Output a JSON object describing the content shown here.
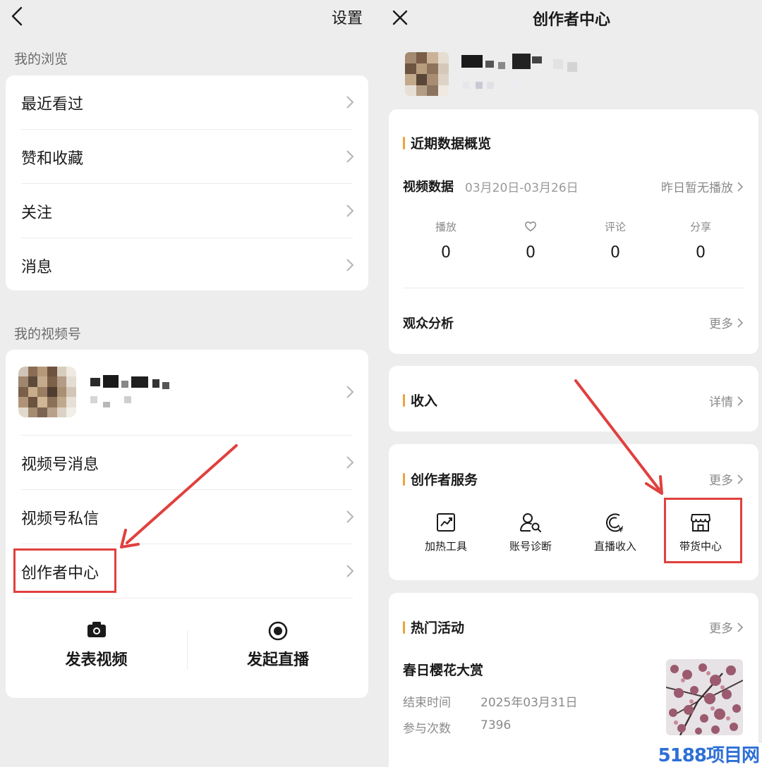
{
  "left": {
    "title": "设置",
    "browse_section": "我的浏览",
    "browse_items": [
      "最近看过",
      "赞和收藏",
      "关注",
      "消息"
    ],
    "channel_section": "我的视频号",
    "channel_items": [
      "视频号消息",
      "视频号私信",
      "创作者中心"
    ],
    "actions": {
      "post_video": "发表视频",
      "start_live": "发起直播"
    }
  },
  "right": {
    "title": "创作者中心",
    "overview": {
      "title": "近期数据概览",
      "video_data_label": "视频数据",
      "date_range": "03月20日-03月26日",
      "yesterday_note": "昨日暂无播放",
      "stats": [
        {
          "label": "播放",
          "value": "0"
        },
        {
          "label": "",
          "value": "0",
          "icon": "heart-icon"
        },
        {
          "label": "评论",
          "value": "0"
        },
        {
          "label": "分享",
          "value": "0"
        }
      ],
      "audience_label": "观众分析",
      "audience_more": "更多"
    },
    "income": {
      "title": "收入",
      "detail": "详情"
    },
    "services": {
      "title": "创作者服务",
      "more": "更多",
      "items": [
        {
          "label": "加热工具",
          "icon": "trend-chart-icon"
        },
        {
          "label": "账号诊断",
          "icon": "user-search-icon"
        },
        {
          "label": "直播收入",
          "icon": "yuan-coin-icon"
        },
        {
          "label": "带货中心",
          "icon": "storefront-icon"
        }
      ]
    },
    "events": {
      "title": "热门活动",
      "more": "更多",
      "event_name": "春日樱花大赏",
      "end_label": "结束时间",
      "end_value": "2025年03月31日",
      "count_label": "参与次数",
      "count_value": "7396"
    }
  },
  "watermark": "5188项目网",
  "colors": {
    "accent_bar": "#f0a23a",
    "highlight": "#e0403e",
    "watermark": "#2d6fd6"
  }
}
